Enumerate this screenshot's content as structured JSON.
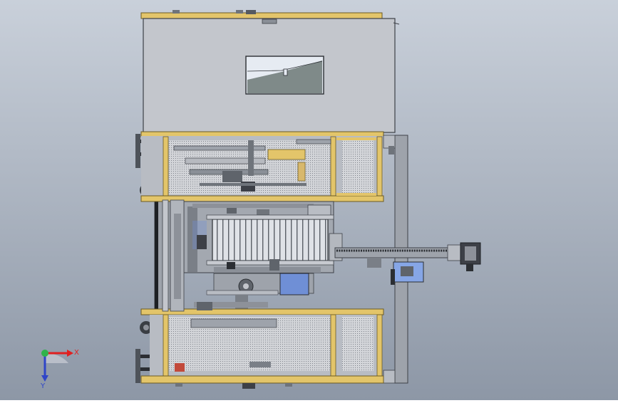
{
  "viewport": {
    "background_top": "#c9d0da",
    "background_bottom": "#8d97a6"
  },
  "colors": {
    "frame_gold": "#e3c56a",
    "frame_gold_dark": "#b1913a",
    "cover_gray": "#c3c6cc",
    "steel": "#9ea3ab",
    "steel_dark": "#555a61",
    "window_glass": "#d9e1ea",
    "accent_blue": "#6f8fd6"
  },
  "triad": {
    "x_label": "X",
    "y_label": "Y",
    "x_color": "#e02020",
    "y_color": "#2f45c8",
    "origin_color": "#2fb34a",
    "icon": "coordinate-triad-icon"
  }
}
